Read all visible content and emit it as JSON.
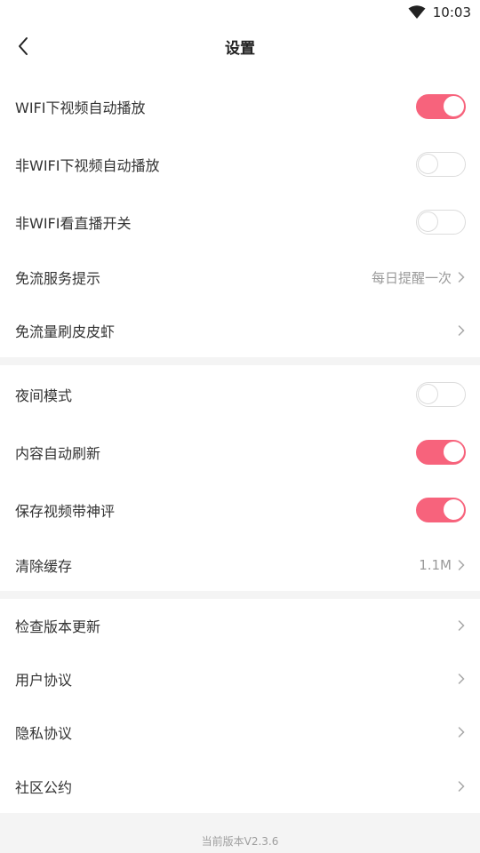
{
  "status_bar": {
    "time": "10:03",
    "wifi_icon": "wifi-icon"
  },
  "header": {
    "title": "设置",
    "back_icon": "back-arrow-icon"
  },
  "colors": {
    "accent": "#f7637c",
    "toggle_off_border": "#dcdcdc",
    "secondary_text": "#9a9a9a"
  },
  "section1": {
    "wifi_autoplay": {
      "label": "WIFI下视频自动播放",
      "on": true
    },
    "non_wifi_autoplay": {
      "label": "非WIFI下视频自动播放",
      "on": false
    },
    "non_wifi_live": {
      "label": "非WIFI看直播开关",
      "on": false
    },
    "free_data_hint": {
      "label": "免流服务提示",
      "value": "每日提醒一次"
    },
    "free_data_pipi": {
      "label": "免流量刷皮皮虾"
    }
  },
  "section2": {
    "night_mode": {
      "label": "夜间模式",
      "on": false
    },
    "auto_refresh": {
      "label": "内容自动刷新",
      "on": true
    },
    "save_with_comments": {
      "label": "保存视频带神评",
      "on": true
    },
    "clear_cache": {
      "label": "清除缓存",
      "value": "1.1M"
    }
  },
  "section3": {
    "check_update": {
      "label": "检查版本更新"
    },
    "user_agreement": {
      "label": "用户协议"
    },
    "privacy_policy": {
      "label": "隐私协议"
    },
    "community_rules": {
      "label": "社区公约"
    }
  },
  "footer": {
    "version": "当前版本V2.3.6"
  }
}
